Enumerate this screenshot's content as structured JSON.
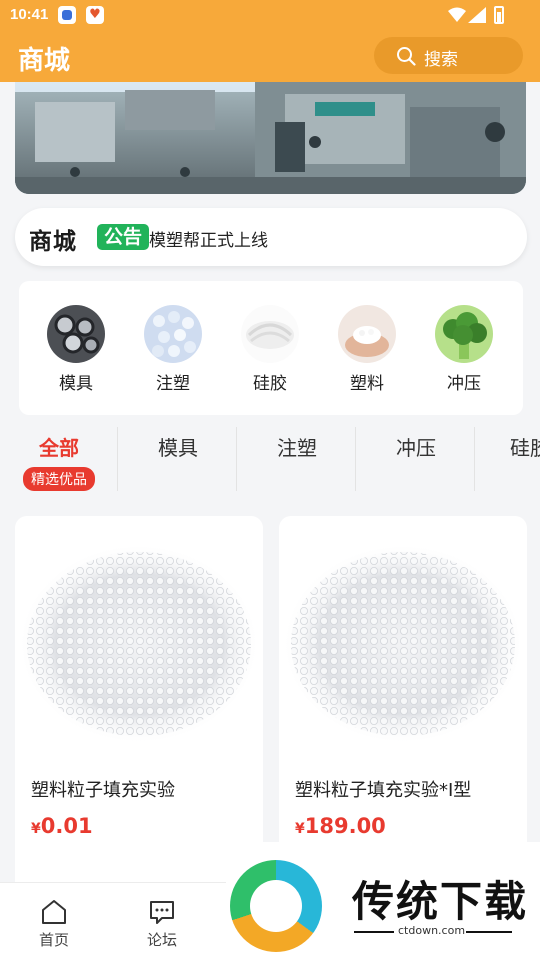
{
  "status": {
    "time": "10:41"
  },
  "header": {
    "title": "商城",
    "search_label": "搜索"
  },
  "notice": {
    "brand": "商城",
    "badge": "公告",
    "message": "模塑帮正式上线"
  },
  "categories": [
    {
      "label": "模具"
    },
    {
      "label": "注塑"
    },
    {
      "label": "硅胶"
    },
    {
      "label": "塑料"
    },
    {
      "label": "冲压"
    }
  ],
  "tabs": [
    {
      "label": "全部",
      "sub": "精选优品",
      "active": true
    },
    {
      "label": "模具"
    },
    {
      "label": "注塑"
    },
    {
      "label": "冲压"
    },
    {
      "label": "硅胶"
    }
  ],
  "products": [
    {
      "name": "塑料粒子填充实验",
      "currency": "¥",
      "price": "0.01"
    },
    {
      "name": "塑料粒子填充实验*I型",
      "currency": "¥",
      "price": "189.00"
    }
  ],
  "bottom_nav": [
    {
      "label": "首页",
      "icon": "home-icon"
    },
    {
      "label": "论坛",
      "icon": "forum-icon"
    }
  ],
  "watermark": {
    "text": "传统下载",
    "url": "ctdown.com"
  },
  "colors": {
    "header": "#f7a93a",
    "accent": "#e83a2f",
    "badge": "#21b35a"
  }
}
